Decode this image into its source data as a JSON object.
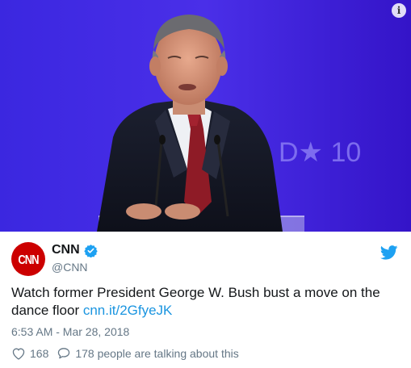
{
  "media": {
    "backdrop_text_top": "",
    "backdrop_text_right": "D★ 10"
  },
  "tweet": {
    "display_name": "CNN",
    "handle": "@CNN",
    "avatar_text": "CNN",
    "text_main": "Watch former President George W. Bush bust a move on the dance floor ",
    "link_text": "cnn.it/2GfyeJK",
    "timestamp": "6:53 AM - Mar 28, 2018",
    "like_count": "168",
    "conversation_text": "178 people are talking about this"
  },
  "icons": {
    "info": "info-icon",
    "verified": "verified-badge-icon",
    "brand": "twitter-bird-icon",
    "like": "heart-icon",
    "reply": "speech-bubble-icon"
  },
  "colors": {
    "link": "#1b95e0",
    "muted": "#657786",
    "brand_avatar": "#cc0000",
    "media_bg": "#3a1fd6"
  }
}
